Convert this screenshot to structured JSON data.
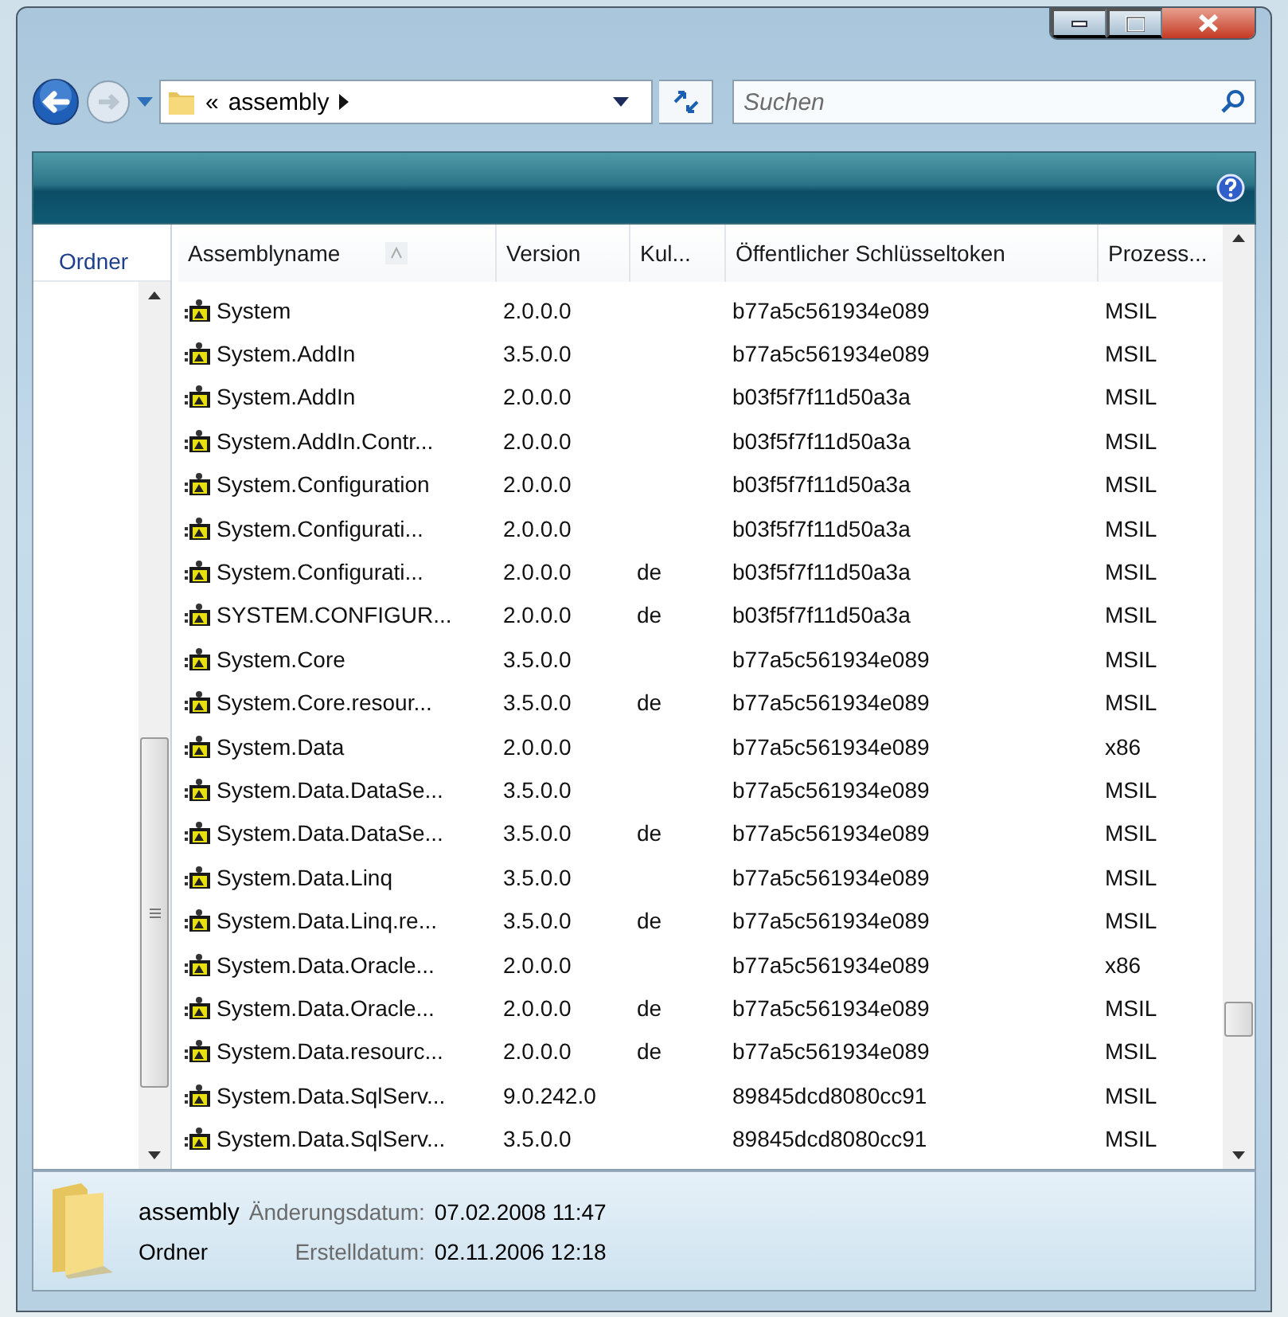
{
  "address_bar": {
    "overflow": "«",
    "folder": "assembly"
  },
  "search": {
    "placeholder": "Suchen"
  },
  "navigation_pane": {
    "header": "Ordner"
  },
  "table": {
    "columns": [
      {
        "label": "Assemblyname",
        "sorted": true
      },
      {
        "label": "Version",
        "sorted": false
      },
      {
        "label": "Kul...",
        "sorted": false
      },
      {
        "label": "Öffentlicher Schlüsseltoken",
        "sorted": false
      },
      {
        "label": "Prozess...",
        "sorted": false
      }
    ],
    "rows": [
      {
        "name": "System",
        "version": "2.0.0.0",
        "culture": "",
        "token": "b77a5c561934e089",
        "processor": "MSIL"
      },
      {
        "name": "System.AddIn",
        "version": "3.5.0.0",
        "culture": "",
        "token": "b77a5c561934e089",
        "processor": "MSIL"
      },
      {
        "name": "System.AddIn",
        "version": "2.0.0.0",
        "culture": "",
        "token": "b03f5f7f11d50a3a",
        "processor": "MSIL"
      },
      {
        "name": "System.AddIn.Contr...",
        "version": "2.0.0.0",
        "culture": "",
        "token": "b03f5f7f11d50a3a",
        "processor": "MSIL"
      },
      {
        "name": "System.Configuration",
        "version": "2.0.0.0",
        "culture": "",
        "token": "b03f5f7f11d50a3a",
        "processor": "MSIL"
      },
      {
        "name": "System.Configurati...",
        "version": "2.0.0.0",
        "culture": "",
        "token": "b03f5f7f11d50a3a",
        "processor": "MSIL"
      },
      {
        "name": "System.Configurati...",
        "version": "2.0.0.0",
        "culture": "de",
        "token": "b03f5f7f11d50a3a",
        "processor": "MSIL"
      },
      {
        "name": "SYSTEM.CONFIGUR...",
        "version": "2.0.0.0",
        "culture": "de",
        "token": "b03f5f7f11d50a3a",
        "processor": "MSIL"
      },
      {
        "name": "System.Core",
        "version": "3.5.0.0",
        "culture": "",
        "token": "b77a5c561934e089",
        "processor": "MSIL"
      },
      {
        "name": "System.Core.resour...",
        "version": "3.5.0.0",
        "culture": "de",
        "token": "b77a5c561934e089",
        "processor": "MSIL"
      },
      {
        "name": "System.Data",
        "version": "2.0.0.0",
        "culture": "",
        "token": "b77a5c561934e089",
        "processor": "x86"
      },
      {
        "name": "System.Data.DataSe...",
        "version": "3.5.0.0",
        "culture": "",
        "token": "b77a5c561934e089",
        "processor": "MSIL"
      },
      {
        "name": "System.Data.DataSe...",
        "version": "3.5.0.0",
        "culture": "de",
        "token": "b77a5c561934e089",
        "processor": "MSIL"
      },
      {
        "name": "System.Data.Linq",
        "version": "3.5.0.0",
        "culture": "",
        "token": "b77a5c561934e089",
        "processor": "MSIL"
      },
      {
        "name": "System.Data.Linq.re...",
        "version": "3.5.0.0",
        "culture": "de",
        "token": "b77a5c561934e089",
        "processor": "MSIL"
      },
      {
        "name": "System.Data.Oracle...",
        "version": "2.0.0.0",
        "culture": "",
        "token": "b77a5c561934e089",
        "processor": "x86"
      },
      {
        "name": "System.Data.Oracle...",
        "version": "2.0.0.0",
        "culture": "de",
        "token": "b77a5c561934e089",
        "processor": "MSIL"
      },
      {
        "name": "System.Data.resourc...",
        "version": "2.0.0.0",
        "culture": "de",
        "token": "b77a5c561934e089",
        "processor": "MSIL"
      },
      {
        "name": "System.Data.SqlServ...",
        "version": "9.0.242.0",
        "culture": "",
        "token": "89845dcd8080cc91",
        "processor": "MSIL"
      },
      {
        "name": "System.Data.SqlServ...",
        "version": "3.5.0.0",
        "culture": "",
        "token": "89845dcd8080cc91",
        "processor": "MSIL"
      }
    ]
  },
  "details": {
    "name": "assembly",
    "type": "Ordner",
    "fields": [
      {
        "label": "Änderungsdatum:",
        "value": "07.02.2008 11:47"
      },
      {
        "label": "Erstelldatum:",
        "value": "02.11.2006 12:18"
      }
    ]
  }
}
